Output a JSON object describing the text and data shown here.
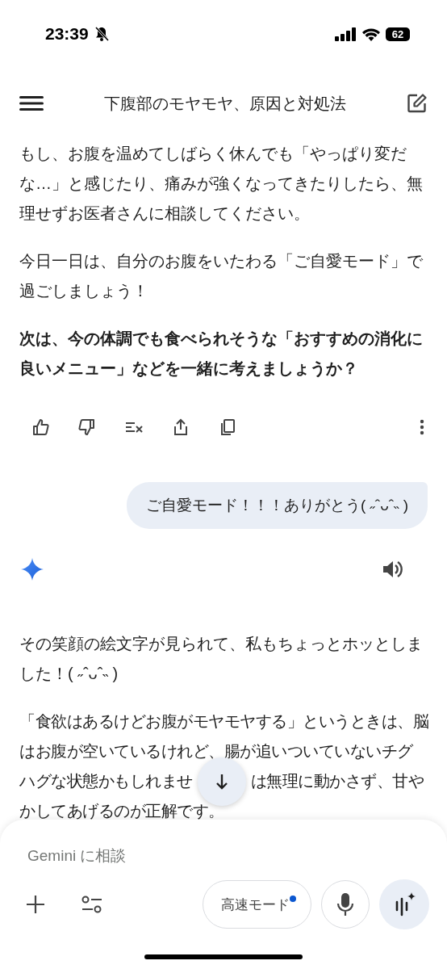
{
  "status_bar": {
    "time": "23:39",
    "battery": "62"
  },
  "header": {
    "title": "下腹部のモヤモヤ、原因と対処法"
  },
  "previous_response": {
    "paragraphs": [
      {
        "text": "もし、お腹を温めてしばらく休んでも「やっぱり変だな…」と感じたり、痛みが強くなってきたりしたら、無理せずお医者さんに相談してください。",
        "bold": false
      },
      {
        "text": "今日一日は、自分のお腹をいたわる「ご自愛モード」で過ごしましょう！",
        "bold": false
      },
      {
        "text": "次は、今の体調でも食べられそうな「おすすめの消化に良いメニュー」などを一緒に考えましょうか？",
        "bold": true
      }
    ]
  },
  "user_message": {
    "text": "ご自愛モード！！！ありがとう( ˶ˆᴗˆ˵ )"
  },
  "response": {
    "paragraphs": [
      {
        "text": "その笑顔の絵文字が見られて、私もちょっとホッとしました！( ˶ˆᴗˆ˵ )",
        "bold": false
      },
      {
        "kind": "lines",
        "bold": false,
        "lines": [
          [
            "「食欲はあるけどお腹がモヤモヤする」というときは、脳"
          ],
          [
            "はお腹が空いているけれど、腸が追いついていないチグ"
          ],
          [
            "ハグな状態かもしれませ",
            "は無理に動かさず、甘や"
          ],
          [
            "かしてあげるのが正解です。"
          ]
        ]
      }
    ]
  },
  "composer": {
    "placeholder": "Gemini に相談",
    "mode_button": {
      "label": "高速モード",
      "dot": true
    }
  }
}
